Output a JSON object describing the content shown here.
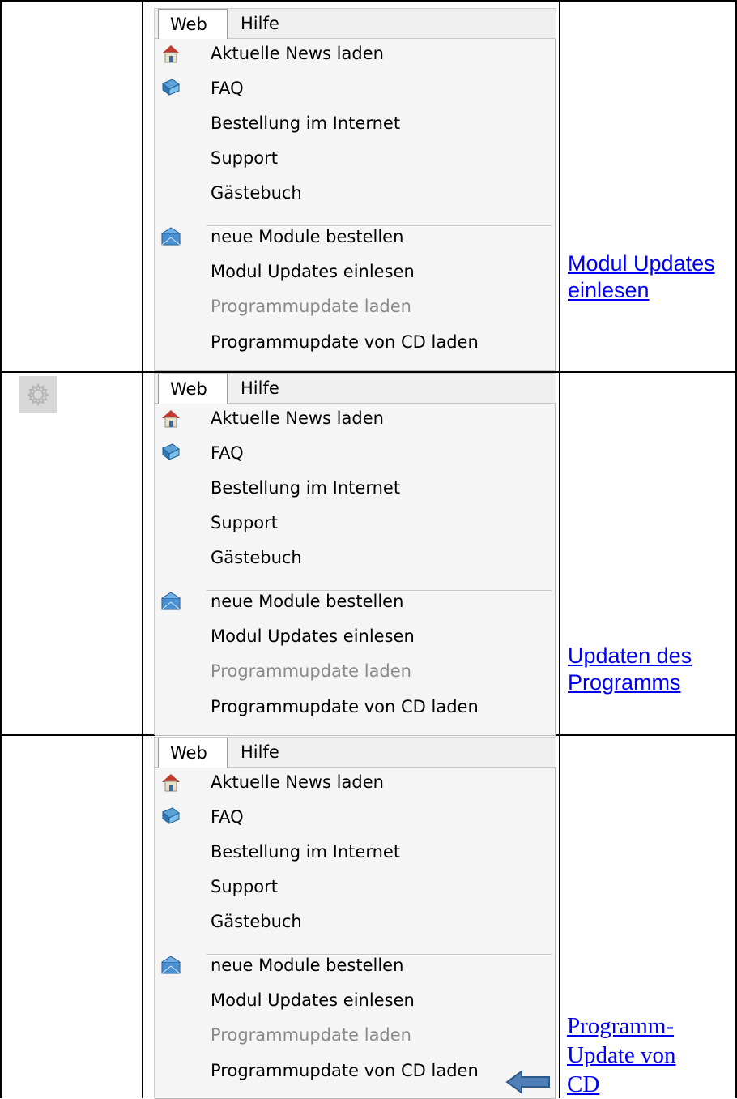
{
  "menu": {
    "tabs": [
      "Web",
      "Hilfe"
    ],
    "items": [
      {
        "label": "Aktuelle News laden",
        "icon": "home-icon",
        "disabled": false
      },
      {
        "label": "FAQ",
        "icon": "book-icon",
        "disabled": false
      },
      {
        "label": "Bestellung im Internet",
        "icon": "",
        "disabled": false
      },
      {
        "label": "Support",
        "icon": "",
        "disabled": false
      },
      {
        "label": "Gästebuch",
        "icon": "",
        "disabled": false
      },
      {
        "label": "neue Module bestellen",
        "icon": "mail-icon",
        "disabled": false
      },
      {
        "label": "Modul Updates einlesen",
        "icon": "",
        "disabled": false
      },
      {
        "label": "Programmupdate laden",
        "icon": "",
        "disabled": true
      },
      {
        "label": "Programmupdate von CD laden",
        "icon": "",
        "disabled": false
      }
    ]
  },
  "rows": [
    {
      "link_lines": [
        "Modul Updates",
        "einlesen"
      ]
    },
    {
      "link_lines": [
        "Updaten des ",
        "Programms"
      ]
    },
    {
      "link_lines": [
        "Programm-",
        "Update von ",
        "CD"
      ]
    }
  ],
  "colors": {
    "link": "#0000ee",
    "disabled_text": "#8a8a8a",
    "menu_bg": "#f0f0f0"
  },
  "icons": {
    "row2_left": "gear-icon",
    "arrow": "left-arrow-icon"
  }
}
